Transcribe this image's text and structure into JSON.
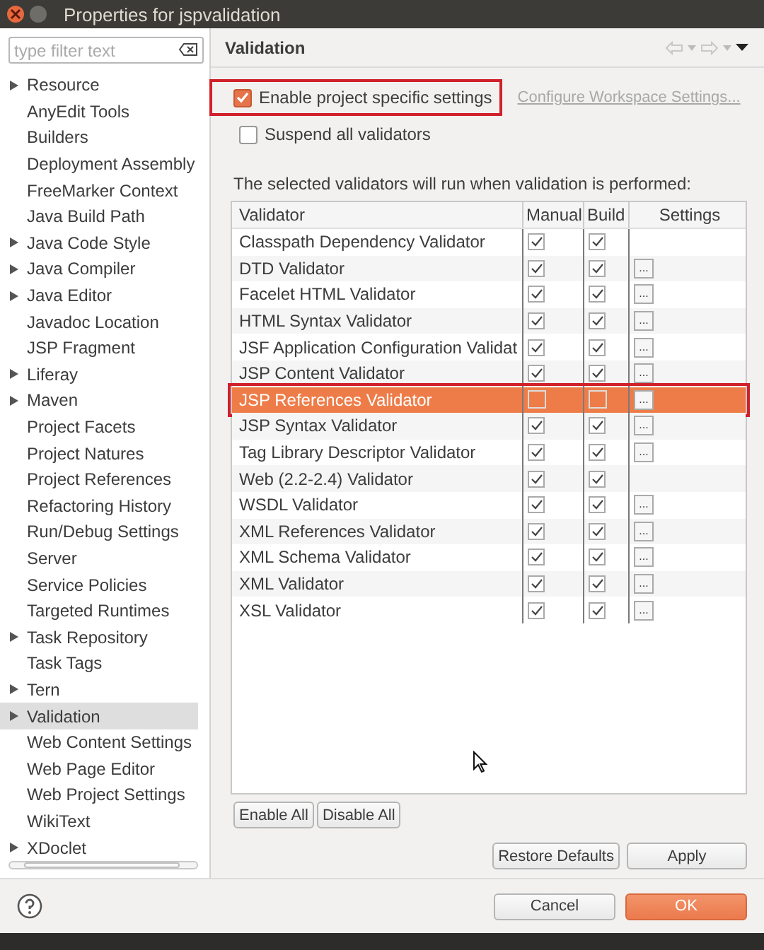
{
  "window": {
    "title": "Properties for jspvalidation"
  },
  "filter": {
    "placeholder": "type filter text"
  },
  "sidebar": {
    "items": [
      {
        "label": "Resource",
        "expandable": true,
        "selected": false
      },
      {
        "label": "AnyEdit Tools",
        "expandable": false,
        "selected": false
      },
      {
        "label": "Builders",
        "expandable": false,
        "selected": false
      },
      {
        "label": "Deployment Assembly",
        "expandable": false,
        "selected": false
      },
      {
        "label": "FreeMarker Context",
        "expandable": false,
        "selected": false
      },
      {
        "label": "Java Build Path",
        "expandable": false,
        "selected": false
      },
      {
        "label": "Java Code Style",
        "expandable": true,
        "selected": false
      },
      {
        "label": "Java Compiler",
        "expandable": true,
        "selected": false
      },
      {
        "label": "Java Editor",
        "expandable": true,
        "selected": false
      },
      {
        "label": "Javadoc Location",
        "expandable": false,
        "selected": false
      },
      {
        "label": "JSP Fragment",
        "expandable": false,
        "selected": false
      },
      {
        "label": "Liferay",
        "expandable": true,
        "selected": false
      },
      {
        "label": "Maven",
        "expandable": true,
        "selected": false
      },
      {
        "label": "Project Facets",
        "expandable": false,
        "selected": false
      },
      {
        "label": "Project Natures",
        "expandable": false,
        "selected": false
      },
      {
        "label": "Project References",
        "expandable": false,
        "selected": false
      },
      {
        "label": "Refactoring History",
        "expandable": false,
        "selected": false
      },
      {
        "label": "Run/Debug Settings",
        "expandable": false,
        "selected": false
      },
      {
        "label": "Server",
        "expandable": false,
        "selected": false
      },
      {
        "label": "Service Policies",
        "expandable": false,
        "selected": false
      },
      {
        "label": "Targeted Runtimes",
        "expandable": false,
        "selected": false
      },
      {
        "label": "Task Repository",
        "expandable": true,
        "selected": false
      },
      {
        "label": "Task Tags",
        "expandable": false,
        "selected": false
      },
      {
        "label": "Tern",
        "expandable": true,
        "selected": false
      },
      {
        "label": "Validation",
        "expandable": true,
        "selected": true
      },
      {
        "label": "Web Content Settings",
        "expandable": false,
        "selected": false
      },
      {
        "label": "Web Page Editor",
        "expandable": false,
        "selected": false
      },
      {
        "label": "Web Project Settings",
        "expandable": false,
        "selected": false
      },
      {
        "label": "WikiText",
        "expandable": false,
        "selected": false
      },
      {
        "label": "XDoclet",
        "expandable": true,
        "selected": false
      }
    ]
  },
  "page": {
    "title": "Validation",
    "enable_project": {
      "label": "Enable project specific settings",
      "checked": true,
      "highlighted": true
    },
    "workspace_link": "Configure Workspace Settings...",
    "suspend_all": {
      "label": "Suspend all validators",
      "checked": false
    },
    "note": "The selected validators will run when validation is performed:",
    "table": {
      "columns": [
        "Validator",
        "Manual",
        "Build",
        "Settings"
      ],
      "rows": [
        {
          "name": "Classpath Dependency Validator",
          "manual": true,
          "build": true,
          "settings_button": false,
          "selected": false,
          "highlighted": false
        },
        {
          "name": "DTD Validator",
          "manual": true,
          "build": true,
          "settings_button": true,
          "selected": false,
          "highlighted": false
        },
        {
          "name": "Facelet HTML Validator",
          "manual": true,
          "build": true,
          "settings_button": true,
          "selected": false,
          "highlighted": false
        },
        {
          "name": "HTML Syntax Validator",
          "manual": true,
          "build": true,
          "settings_button": true,
          "selected": false,
          "highlighted": false
        },
        {
          "name": "JSF Application Configuration Validat",
          "manual": true,
          "build": true,
          "settings_button": true,
          "selected": false,
          "highlighted": false
        },
        {
          "name": "JSP Content Validator",
          "manual": true,
          "build": true,
          "settings_button": true,
          "selected": false,
          "highlighted": false
        },
        {
          "name": "JSP References Validator",
          "manual": false,
          "build": false,
          "settings_button": true,
          "selected": true,
          "highlighted": true
        },
        {
          "name": "JSP Syntax Validator",
          "manual": true,
          "build": true,
          "settings_button": true,
          "selected": false,
          "highlighted": false
        },
        {
          "name": "Tag Library Descriptor Validator",
          "manual": true,
          "build": true,
          "settings_button": true,
          "selected": false,
          "highlighted": false
        },
        {
          "name": "Web (2.2-2.4) Validator",
          "manual": true,
          "build": true,
          "settings_button": false,
          "selected": false,
          "highlighted": false
        },
        {
          "name": "WSDL Validator",
          "manual": true,
          "build": true,
          "settings_button": true,
          "selected": false,
          "highlighted": false
        },
        {
          "name": "XML References Validator",
          "manual": true,
          "build": true,
          "settings_button": true,
          "selected": false,
          "highlighted": false
        },
        {
          "name": "XML Schema Validator",
          "manual": true,
          "build": true,
          "settings_button": true,
          "selected": false,
          "highlighted": false
        },
        {
          "name": "XML Validator",
          "manual": true,
          "build": true,
          "settings_button": true,
          "selected": false,
          "highlighted": false
        },
        {
          "name": "XSL Validator",
          "manual": true,
          "build": true,
          "settings_button": true,
          "selected": false,
          "highlighted": false
        }
      ]
    },
    "settings_button_label": "...",
    "table_buttons": [
      "Enable All",
      "Disable All"
    ],
    "page_buttons": [
      "Restore Defaults",
      "Apply"
    ]
  },
  "dialog_buttons": [
    {
      "label": "Cancel",
      "default": false
    },
    {
      "label": "OK",
      "default": true
    }
  ]
}
